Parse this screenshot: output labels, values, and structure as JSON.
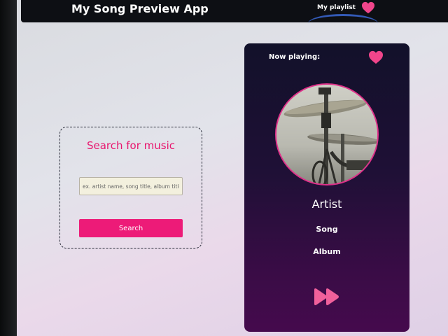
{
  "navbar": {
    "title": "My Song Preview App",
    "playlist_link": "My playlist",
    "heart_icon": "heart-icon"
  },
  "search": {
    "title": "Search for music",
    "placeholder": "ex. artist name, song title, album title",
    "button_label": "Search"
  },
  "player": {
    "now_playing_label": "Now playing:",
    "artist": "Artist",
    "song": "Song",
    "album": "Album",
    "cover_icon": "drum-kit-cover-image",
    "next_icon": "fast-forward-icon"
  },
  "colors": {
    "accent": "#ed1b78",
    "heart": "#f0458b",
    "navbar": "#0d0f14",
    "player_top": "#12112a",
    "player_bottom": "#450a4d"
  }
}
